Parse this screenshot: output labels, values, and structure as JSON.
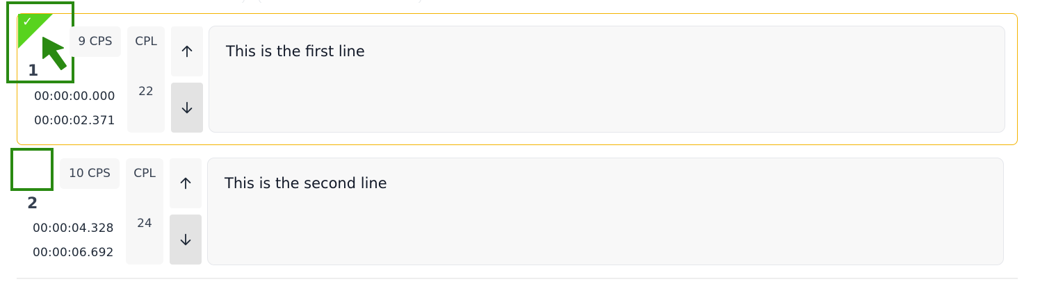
{
  "colors": {
    "selected_border": "#f4b400",
    "checked_fill": "#58d31e",
    "highlight_frame": "#2a8a12"
  },
  "rows": [
    {
      "number": "1",
      "start_time": "00:00:00.000",
      "end_time": "00:00:02.371",
      "cps_label": "9 CPS",
      "cpl_label": "CPL",
      "cpl_value": "22",
      "text": "This is the first line",
      "checked": true,
      "selected": true
    },
    {
      "number": "2",
      "start_time": "00:00:04.328",
      "end_time": "00:00:06.692",
      "cps_label": "10 CPS",
      "cpl_label": "CPL",
      "cpl_value": "24",
      "text": "This is the second line",
      "checked": false,
      "selected": false
    }
  ],
  "icons": {
    "check": "check-icon",
    "move_up": "arrow-up-icon",
    "move_down": "arrow-down-icon",
    "cursor": "mouse-pointer-icon"
  }
}
